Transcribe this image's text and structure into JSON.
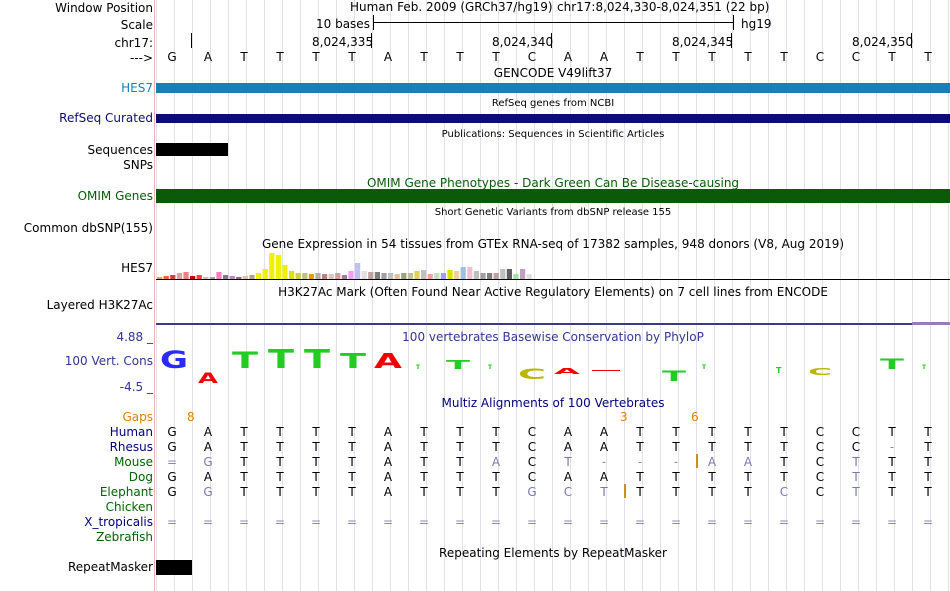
{
  "header": {
    "window_position_label": "Window Position",
    "assembly_text": "Human Feb. 2009 (GRCh37/hg19)",
    "position_text": "chr17:8,024,330-8,024,351 (22 bp)",
    "scale_label": "Scale",
    "scale_text": "10 bases",
    "scale_db": "hg19",
    "chrom_label": "chr17:",
    "strand_label": "--->",
    "coords": [
      "8,024,335",
      "8,024,340",
      "8,024,345",
      "8,024,350"
    ]
  },
  "sequence": [
    "G",
    "A",
    "T",
    "T",
    "T",
    "T",
    "A",
    "T",
    "T",
    "T",
    "C",
    "A",
    "A",
    "T",
    "T",
    "T",
    "T",
    "T",
    "C",
    "C",
    "T",
    "T"
  ],
  "tracks": {
    "gencode": {
      "title": "GENCODE V49lift37",
      "gene": "HES7",
      "color": "#1a7fb8"
    },
    "refseq": {
      "title": "RefSeq genes from NCBI",
      "label": "RefSeq Curated",
      "color": "#0c0c78"
    },
    "pubs": {
      "title": "Publications: Sequences in Scientific Articles",
      "label1": "Sequences",
      "label2": "SNPs"
    },
    "omim": {
      "title": "OMIM Gene Phenotypes - Dark Green Can Be Disease-causing",
      "label": "OMIM Genes",
      "color": "#0a5a0a"
    },
    "dbsnp": {
      "title": "Short Genetic Variants from dbSNP release 155",
      "label": "Common dbSNP(155)"
    },
    "gtex": {
      "title": "Gene Expression in 54 tissues from GTEx RNA-seq of 17382 samples, 948 donors (V8, Aug 2019)",
      "label": "HES7"
    },
    "h3k27ac": {
      "title": "H3K27Ac Mark (Often Found Near Active Regulatory Elements) on 7 cell lines from ENCODE",
      "label": "Layered H3K27Ac"
    },
    "phylop": {
      "title": "100 vertebrates Basewise Conservation by PhyloP",
      "label": "100 Vert. Cons",
      "max": "4.88 _",
      "min": "-4.5 _"
    },
    "multiz": {
      "title": "Multiz Alignments of 100 Vertebrates",
      "gaps_label": "Gaps",
      "gap_marks": [
        "8",
        "3",
        "6"
      ],
      "species": [
        {
          "name": "Human",
          "color": "#000080",
          "bases": [
            "G",
            "A",
            "T",
            "T",
            "T",
            "T",
            "A",
            "T",
            "T",
            "T",
            "C",
            "A",
            "A",
            "T",
            "T",
            "T",
            "T",
            "T",
            "C",
            "C",
            "T",
            "T"
          ]
        },
        {
          "name": "Rhesus",
          "color": "#000080",
          "bases": [
            "G",
            "A",
            "T",
            "T",
            "T",
            "T",
            "A",
            "T",
            "T",
            "T",
            "C",
            "A",
            "A",
            "T",
            "T",
            "T",
            "T",
            "T",
            "C",
            "C",
            "-",
            "T"
          ]
        },
        {
          "name": "Mouse",
          "color": "#006400",
          "bases": [
            "=",
            "G",
            "T",
            "T",
            "T",
            "T",
            "A",
            "T",
            "T",
            "A",
            "C",
            "T",
            "-",
            "-",
            "-",
            "A",
            "A",
            "T",
            "C",
            "T",
            "T",
            "T"
          ]
        },
        {
          "name": "Dog",
          "color": "#006400",
          "bases": [
            "G",
            "A",
            "T",
            "T",
            "T",
            "T",
            "A",
            "T",
            "T",
            "T",
            "C",
            "A",
            "A",
            "T",
            "T",
            "T",
            "T",
            "T",
            "C",
            "T",
            "T",
            "T"
          ]
        },
        {
          "name": "Elephant",
          "color": "#006400",
          "bases": [
            "G",
            "G",
            "T",
            "T",
            "T",
            "T",
            "A",
            "T",
            "T",
            "T",
            "G",
            "C",
            "T",
            "T",
            "T",
            "T",
            "T",
            "C",
            "C",
            "T",
            "T",
            "T"
          ]
        },
        {
          "name": "Chicken",
          "color": "#006400",
          "bases": []
        },
        {
          "name": "X_tropicalis",
          "color": "#000080",
          "bases": [
            "=",
            "=",
            "=",
            "=",
            "=",
            "=",
            "=",
            "=",
            "=",
            "=",
            "=",
            "=",
            "=",
            "=",
            "=",
            "=",
            "=",
            "=",
            "=",
            "=",
            "=",
            "="
          ]
        },
        {
          "name": "Zebrafish",
          "color": "#006400",
          "bases": []
        }
      ]
    },
    "repeatmasker": {
      "title": "Repeating Elements by RepeatMasker",
      "label": "RepeatMasker"
    }
  }
}
